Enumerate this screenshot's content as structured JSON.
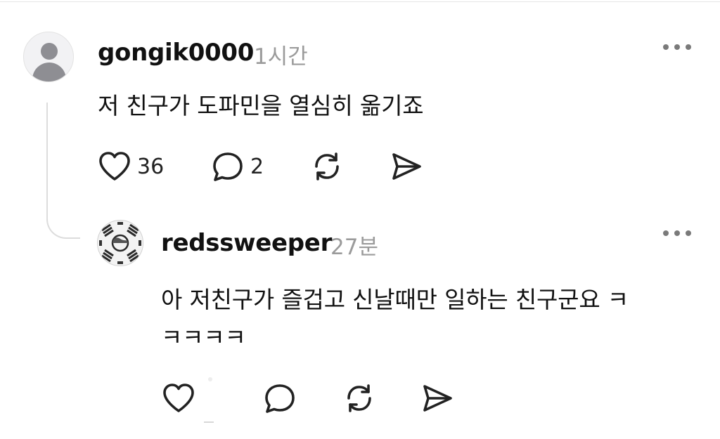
{
  "comment": {
    "username": "gongik0000",
    "time": "1시간",
    "text": "저 친구가 도파민을 열심히 옮기죠",
    "likes": "36",
    "replies": "2"
  },
  "reply": {
    "username": "redssweeper",
    "time": "27분",
    "text_line1": "아 저친구가 즐겁고 신날때만 일하는 친구군요 ㅋ",
    "text_line2": "ㅋㅋㅋㅋ"
  },
  "icons": {
    "like": "heart-icon",
    "reply": "speech-bubble-icon",
    "repost": "repost-icon",
    "share": "send-icon",
    "more": "more-dots-icon"
  }
}
